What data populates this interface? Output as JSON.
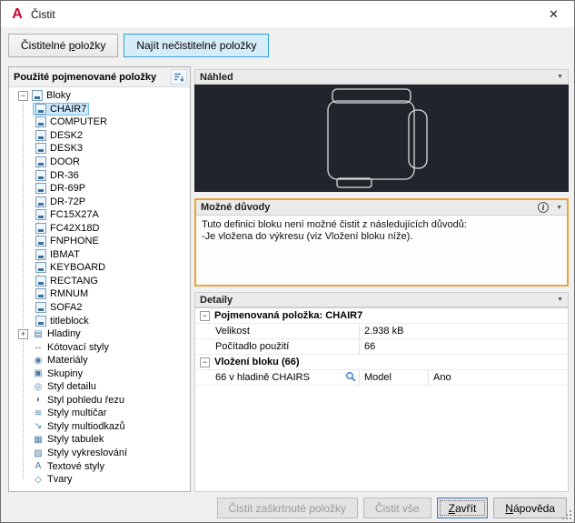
{
  "window": {
    "title": "Čistit"
  },
  "titlebar": {
    "logo_letter": "A",
    "close_glyph": "✕"
  },
  "tabs": [
    {
      "label": "Čistitelné položky",
      "active": false,
      "mnemonic": 11
    },
    {
      "label": "Najít nečistitelné položky",
      "active": true,
      "mnemonic": 2
    }
  ],
  "left_panel": {
    "header": "Použité pojmenované položky",
    "tree": {
      "root_label": "Bloky",
      "selected_block": "CHAIR7",
      "blocks": [
        "CHAIR7",
        "COMPUTER",
        "DESK2",
        "DESK3",
        "DOOR",
        "DR-36",
        "DR-69P",
        "DR-72P",
        "FC15X27A",
        "FC42X18D",
        "FNPHONE",
        "IBMAT",
        "KEYBOARD",
        "RECTANG",
        "RMNUM",
        "SOFA2",
        "titleblock"
      ],
      "categories": [
        {
          "label": "Hladiny",
          "name": "layers",
          "icon": "▤",
          "expandable": true
        },
        {
          "label": "Kótovací styly",
          "name": "dimension-styles",
          "icon": "↔",
          "expandable": false
        },
        {
          "label": "Materiály",
          "name": "materials",
          "icon": "◉",
          "expandable": false
        },
        {
          "label": "Skupiny",
          "name": "groups",
          "icon": "▣",
          "expandable": false
        },
        {
          "label": "Styl detailu",
          "name": "detail-view-style",
          "icon": "◎",
          "expandable": false
        },
        {
          "label": "Styl pohledu řezu",
          "name": "section-view-style",
          "icon": "◗",
          "expandable": false
        },
        {
          "label": "Styly multičar",
          "name": "multiline-styles",
          "icon": "≋",
          "expandable": false
        },
        {
          "label": "Styly multiodkazů",
          "name": "multileader-styles",
          "icon": "↘",
          "expandable": false
        },
        {
          "label": "Styly tabulek",
          "name": "table-styles",
          "icon": "▦",
          "expandable": false
        },
        {
          "label": "Styly vykreslování",
          "name": "plot-styles",
          "icon": "▨",
          "expandable": false
        },
        {
          "label": "Textové styly",
          "name": "text-styles",
          "icon": "A",
          "expandable": false
        },
        {
          "label": "Tvary",
          "name": "shapes",
          "icon": "◇",
          "expandable": false
        }
      ]
    }
  },
  "preview": {
    "header": "Náhled"
  },
  "reasons": {
    "header": "Možné důvody",
    "lines": [
      "Tuto definici bloku není možné čistit z následujících důvodů:",
      "-Je vložena do výkresu (viz Vložení bloku níže)."
    ]
  },
  "details": {
    "header": "Detaily",
    "named_item_header": "Pojmenovaná položka: CHAIR7",
    "rows": [
      {
        "label": "Velikost",
        "value": "2.938 kB"
      },
      {
        "label": "Počítadlo použití",
        "value": "66"
      }
    ],
    "block_insert_header": "Vložení bloku (66)",
    "insert_row": {
      "name": "66 v hladině CHAIRS",
      "layout": "Model",
      "value": "Ano"
    }
  },
  "footer": {
    "buttons": [
      {
        "label": "Čistit zaškrtnuté položky",
        "disabled": true
      },
      {
        "label": "Čistit vše",
        "disabled": true
      },
      {
        "label": "Zavřít",
        "disabled": false,
        "default": true
      },
      {
        "label": "Nápověda",
        "disabled": false
      }
    ]
  },
  "colors": {
    "highlight_orange": "#e8a33d",
    "selection_blue": "#cbe8fc",
    "tab_active_border": "#2f9fd8",
    "preview_background": "#21252b"
  }
}
